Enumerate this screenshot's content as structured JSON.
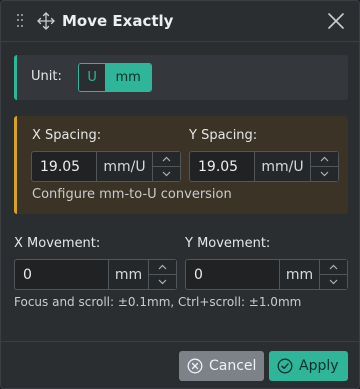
{
  "dialog": {
    "title": "Move Exactly",
    "title_icon": "move-arrows-icon",
    "close_icon": "close-icon"
  },
  "unit": {
    "label": "Unit:",
    "options": [
      "U",
      "mm"
    ],
    "selected": "mm"
  },
  "spacing": {
    "x_label": "X Spacing:",
    "x_value": "19.05",
    "x_unit": "mm/U",
    "y_label": "Y Spacing:",
    "y_value": "19.05",
    "y_unit": "mm/U",
    "configure_link": "Configure mm-to-U conversion"
  },
  "movement": {
    "x_label": "X Movement:",
    "x_value": "0",
    "x_unit": "mm",
    "y_label": "Y Movement:",
    "y_value": "0",
    "y_unit": "mm"
  },
  "hint": "Focus and scroll: ±0.1mm, Ctrl+scroll: ±1.0mm",
  "buttons": {
    "cancel": "Cancel",
    "apply": "Apply"
  },
  "colors": {
    "accent": "#2fb59a",
    "warning": "#d6a126",
    "background": "#2b2e31"
  }
}
